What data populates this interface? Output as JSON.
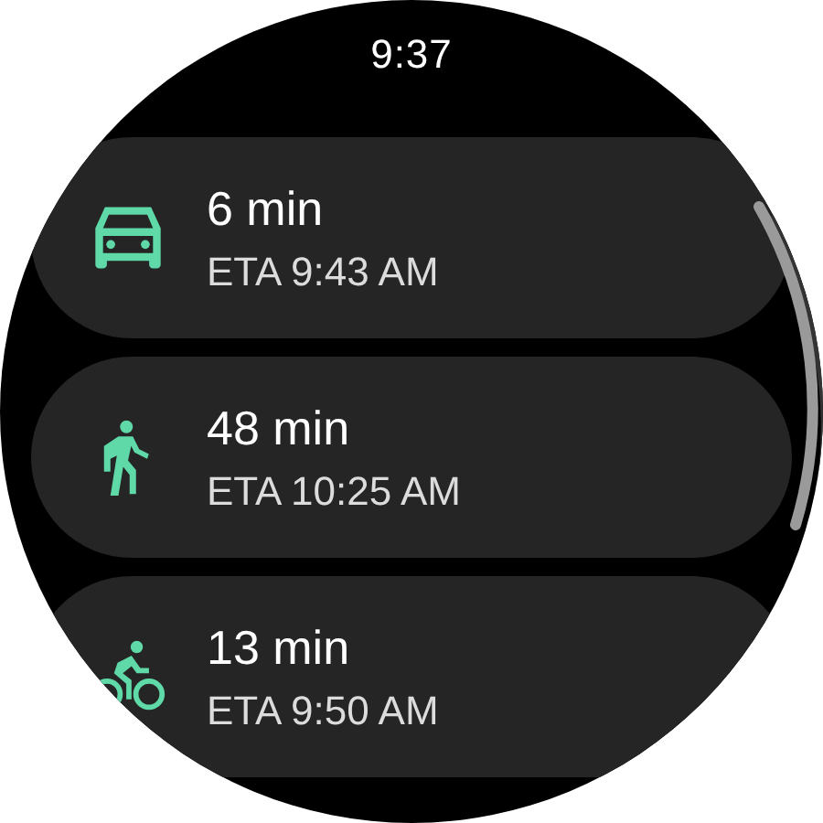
{
  "status_bar": {
    "time": "9:37"
  },
  "routes": [
    {
      "kind": "car",
      "duration": "6 min",
      "eta": "ETA 9:43 AM"
    },
    {
      "kind": "walk",
      "duration": "48 min",
      "eta": "ETA 10:25 AM"
    },
    {
      "kind": "bike",
      "duration": "13 min",
      "eta": "ETA 9:50 AM"
    }
  ]
}
